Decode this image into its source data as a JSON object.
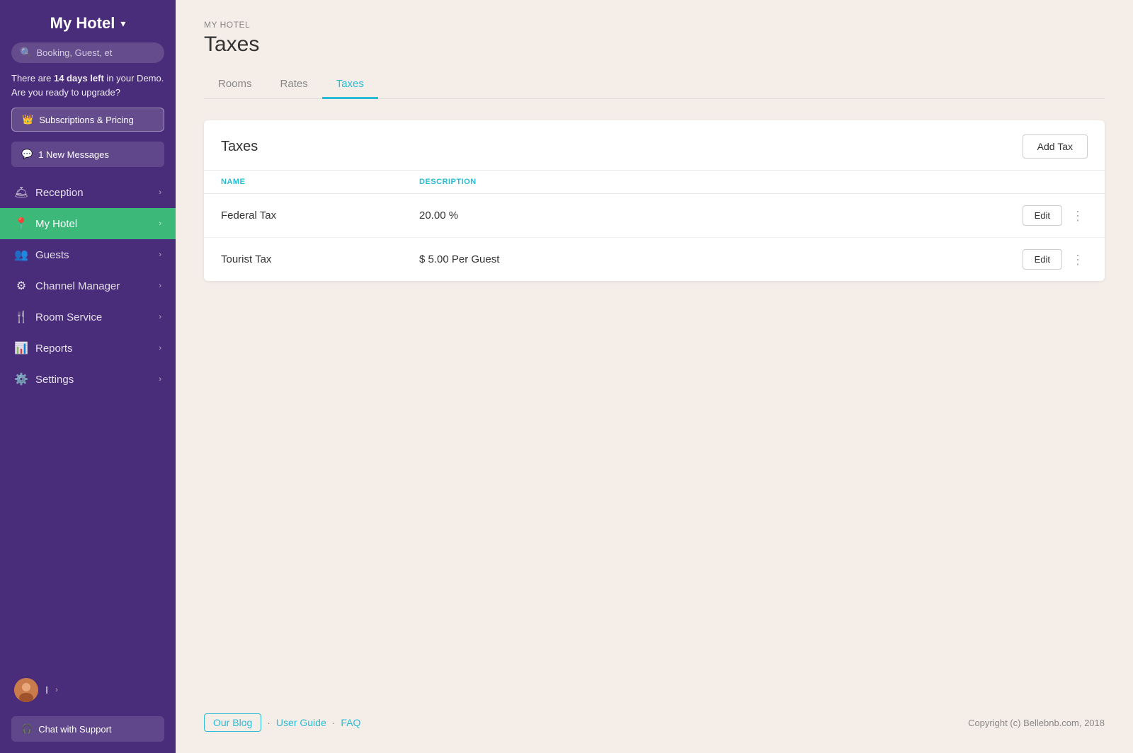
{
  "sidebar": {
    "hotel_name": "My Hotel",
    "search_placeholder": "Booking, Guest, et",
    "demo_text_pre": "There are ",
    "demo_days": "14 days left",
    "demo_text_post": " in your Demo. Are you ready to upgrade?",
    "upgrade_btn": "Subscriptions & Pricing",
    "messages_btn": "1 New Messages",
    "nav_items": [
      {
        "id": "reception",
        "label": "Reception",
        "icon": "🛎",
        "active": false,
        "has_chevron": true
      },
      {
        "id": "my-hotel",
        "label": "My Hotel",
        "icon": "📍",
        "active": true,
        "has_chevron": true
      },
      {
        "id": "guests",
        "label": "Guests",
        "icon": "👥",
        "active": false,
        "has_chevron": true
      },
      {
        "id": "channel-manager",
        "label": "Channel Manager",
        "icon": "⚙",
        "active": false,
        "has_chevron": true
      },
      {
        "id": "room-service",
        "label": "Room Service",
        "icon": "🍴",
        "active": false,
        "has_chevron": true
      },
      {
        "id": "reports",
        "label": "Reports",
        "icon": "📊",
        "active": false,
        "has_chevron": true
      },
      {
        "id": "settings",
        "label": "Settings",
        "icon": "⚙️",
        "active": false,
        "has_chevron": true
      }
    ],
    "user_label": "I",
    "chat_support": "Chat with Support"
  },
  "header": {
    "breadcrumb": "MY HOTEL",
    "page_title": "Taxes"
  },
  "tabs": [
    {
      "id": "rooms",
      "label": "Rooms",
      "active": false
    },
    {
      "id": "rates",
      "label": "Rates",
      "active": false
    },
    {
      "id": "taxes",
      "label": "Taxes",
      "active": true
    }
  ],
  "taxes_card": {
    "title": "Taxes",
    "add_btn": "Add Tax",
    "columns": {
      "name": "NAME",
      "description": "DESCRIPTION"
    },
    "rows": [
      {
        "name": "Federal Tax",
        "description": "20.00 %",
        "edit_btn": "Edit"
      },
      {
        "name": "Tourist Tax",
        "description": "$ 5.00 Per Guest",
        "edit_btn": "Edit"
      }
    ]
  },
  "footer": {
    "blog_link": "Our Blog",
    "guide_link": "User Guide",
    "faq_link": "FAQ",
    "copyright": "Copyright (c) Bellebnb.com, 2018"
  }
}
